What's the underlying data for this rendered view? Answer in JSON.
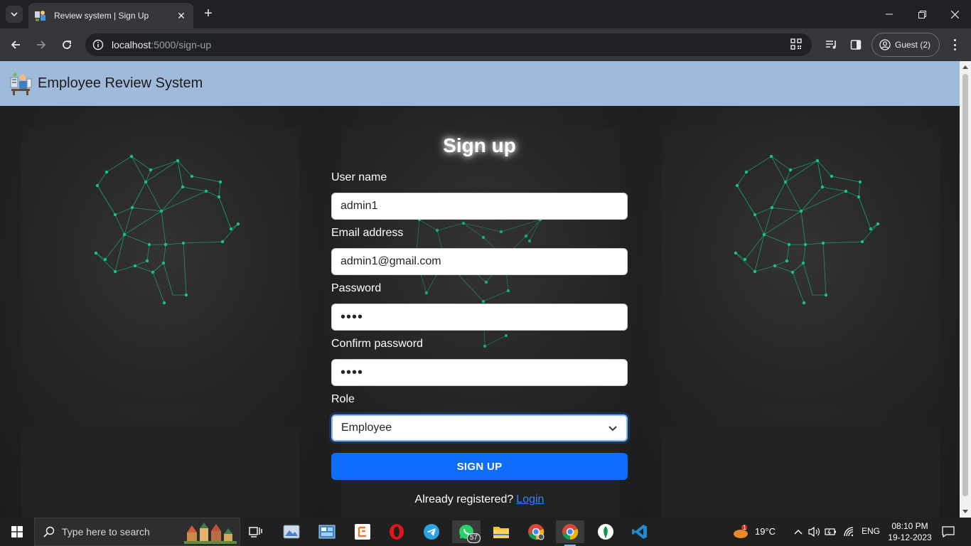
{
  "browser": {
    "tab_title": "Review system | Sign Up",
    "url_host": "localhost",
    "url_rest": ":5000/sign-up",
    "profile_label": "Guest (2)"
  },
  "page": {
    "brand": "Employee Review System",
    "form": {
      "title": "Sign up",
      "username_label": "User name",
      "username_value": "admin1",
      "email_label": "Email address",
      "email_value": "admin1@gmail.com",
      "password_label": "Password",
      "password_value": "••••",
      "confirm_label": "Confirm password",
      "confirm_value": "••••",
      "role_label": "Role",
      "role_value": "Employee",
      "submit_label": "SIGN UP",
      "already_text": "Already registered?",
      "login_link": "Login"
    }
  },
  "taskbar": {
    "search_placeholder": "Type here to search",
    "whatsapp_badge": "57",
    "weather_temp": "19°C",
    "weather_badge": "1",
    "language": "ENG",
    "time": "08:10 PM",
    "date": "19-12-2023"
  },
  "colors": {
    "navbar_bg": "#9fbadb",
    "primary_button": "#0d6efd",
    "link": "#3b82f6",
    "brain_nodes": "#19c37d"
  }
}
